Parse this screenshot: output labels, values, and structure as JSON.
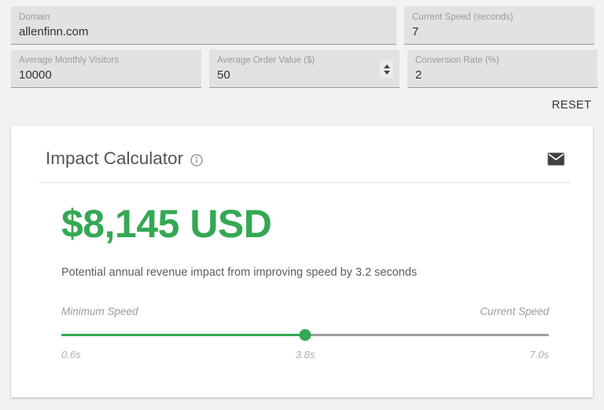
{
  "form": {
    "fields": [
      {
        "label": "Domain",
        "value": "allenfinn.com",
        "spinner": false
      },
      {
        "label": "Current Speed (seconds)",
        "value": "7",
        "spinner": false
      },
      {
        "label": "Average Monthly Visitors",
        "value": "10000",
        "spinner": false
      },
      {
        "label": "Average Order Value ($)",
        "value": "50",
        "spinner": true
      },
      {
        "label": "Conversion Rate (%)",
        "value": "2",
        "spinner": false
      }
    ],
    "reset_label": "RESET"
  },
  "card": {
    "title": "Impact Calculator",
    "info_icon": "info-icon",
    "mail_icon": "envelope-icon",
    "result_amount": "$8,145 USD",
    "result_description": "Potential annual revenue impact from improving speed by 3.2 seconds",
    "accent_color": "#34a853",
    "slider": {
      "left_label": "Minimum Speed",
      "right_label": "Current Speed",
      "min_tick": "0.6s",
      "value_tick": "3.8s",
      "max_tick": "7.0s",
      "fill_percent": "50"
    }
  }
}
